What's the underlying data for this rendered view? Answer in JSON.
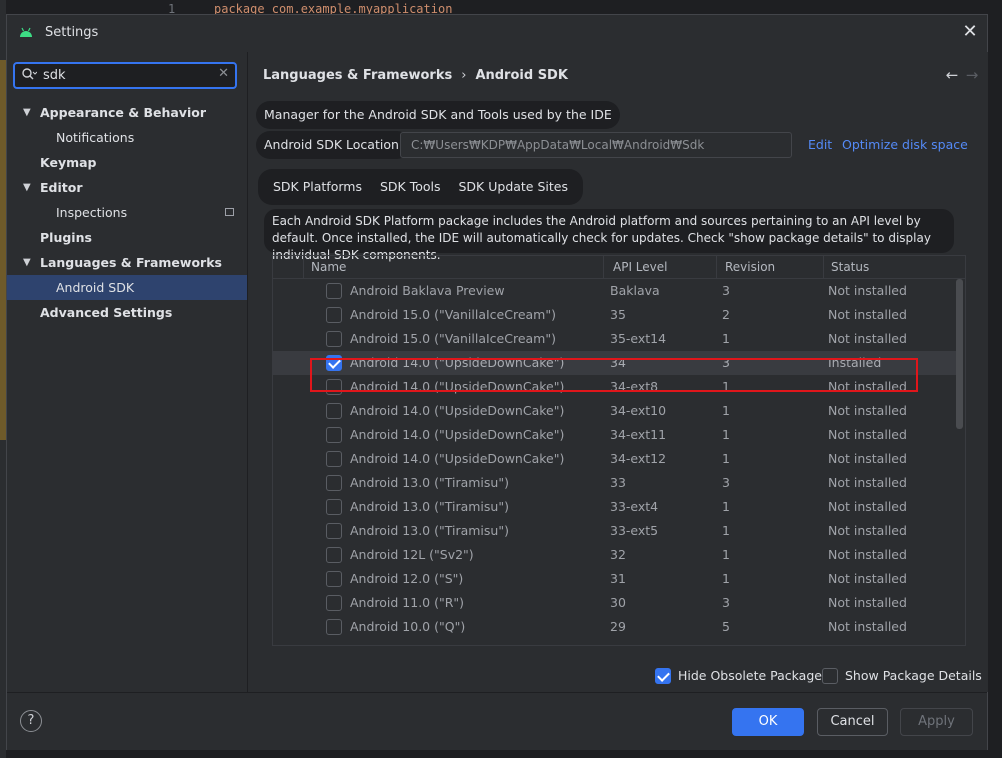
{
  "editor": {
    "line_number": "1",
    "code_snippet": "package com.example.myapplication"
  },
  "window": {
    "title": "Settings",
    "close_icon": "close-icon"
  },
  "search": {
    "value": "sdk"
  },
  "sidebar": {
    "items": [
      {
        "label": "Appearance & Behavior",
        "level": 0,
        "expanded": true
      },
      {
        "label": "Notifications",
        "level": 1
      },
      {
        "label": "Keymap",
        "level": 0
      },
      {
        "label": "Editor",
        "level": 0,
        "expanded": true
      },
      {
        "label": "Inspections",
        "level": 1
      },
      {
        "label": "Plugins",
        "level": 0
      },
      {
        "label": "Languages & Frameworks",
        "level": 0,
        "expanded": true
      },
      {
        "label": "Android SDK",
        "level": 1,
        "selected": true
      },
      {
        "label": "Advanced Settings",
        "level": 0
      }
    ]
  },
  "breadcrumb": {
    "parent": "Languages & Frameworks",
    "current": "Android SDK"
  },
  "sdk": {
    "description": "Manager for the Android SDK and Tools used by the IDE",
    "location_label": "Android SDK Location:",
    "location_value": "C:₩Users₩KDP₩AppData₩Local₩Android₩Sdk",
    "edit_link": "Edit",
    "optimize_link": "Optimize disk space"
  },
  "tabs": [
    {
      "label": "SDK Platforms",
      "active": true
    },
    {
      "label": "SDK Tools"
    },
    {
      "label": "SDK Update Sites"
    }
  ],
  "info_text": "Each Android SDK Platform package includes the Android platform and sources pertaining to an API level by default. Once installed, the IDE will automatically check for updates. Check \"show package details\" to display individual SDK components.",
  "table": {
    "columns": {
      "name": "Name",
      "api": "API Level",
      "revision": "Revision",
      "status": "Status"
    },
    "rows": [
      {
        "name": "Android Baklava Preview",
        "api": "Baklava",
        "revision": "3",
        "status": "Not installed",
        "checked": false
      },
      {
        "name": "Android 15.0 (\"VanillaIceCream\")",
        "api": "35",
        "revision": "2",
        "status": "Not installed",
        "checked": false
      },
      {
        "name": "Android 15.0 (\"VanillaIceCream\")",
        "api": "35-ext14",
        "revision": "1",
        "status": "Not installed",
        "checked": false
      },
      {
        "name": "Android 14.0 (\"UpsideDownCake\")",
        "api": "34",
        "revision": "3",
        "status": "Installed",
        "checked": true
      },
      {
        "name": "Android 14.0 (\"UpsideDownCake\")",
        "api": "34-ext8",
        "revision": "1",
        "status": "Not installed",
        "checked": false
      },
      {
        "name": "Android 14.0 (\"UpsideDownCake\")",
        "api": "34-ext10",
        "revision": "1",
        "status": "Not installed",
        "checked": false
      },
      {
        "name": "Android 14.0 (\"UpsideDownCake\")",
        "api": "34-ext11",
        "revision": "1",
        "status": "Not installed",
        "checked": false
      },
      {
        "name": "Android 14.0 (\"UpsideDownCake\")",
        "api": "34-ext12",
        "revision": "1",
        "status": "Not installed",
        "checked": false
      },
      {
        "name": "Android 13.0 (\"Tiramisu\")",
        "api": "33",
        "revision": "3",
        "status": "Not installed",
        "checked": false
      },
      {
        "name": "Android 13.0 (\"Tiramisu\")",
        "api": "33-ext4",
        "revision": "1",
        "status": "Not installed",
        "checked": false
      },
      {
        "name": "Android 13.0 (\"Tiramisu\")",
        "api": "33-ext5",
        "revision": "1",
        "status": "Not installed",
        "checked": false
      },
      {
        "name": "Android 12L (\"Sv2\")",
        "api": "32",
        "revision": "1",
        "status": "Not installed",
        "checked": false
      },
      {
        "name": "Android 12.0 (\"S\")",
        "api": "31",
        "revision": "1",
        "status": "Not installed",
        "checked": false
      },
      {
        "name": "Android 11.0 (\"R\")",
        "api": "30",
        "revision": "3",
        "status": "Not installed",
        "checked": false
      },
      {
        "name": "Android 10.0 (\"Q\")",
        "api": "29",
        "revision": "5",
        "status": "Not installed",
        "checked": false
      }
    ]
  },
  "options": {
    "hide_obsolete": {
      "label": "Hide Obsolete Packages",
      "checked": true
    },
    "show_details": {
      "label": "Show Package Details",
      "checked": false
    }
  },
  "footer": {
    "help": "?",
    "ok": "OK",
    "cancel": "Cancel",
    "apply": "Apply"
  },
  "colors": {
    "accent": "#3574f0",
    "highlight_box": "#e0161b",
    "selection": "#2e436e"
  }
}
